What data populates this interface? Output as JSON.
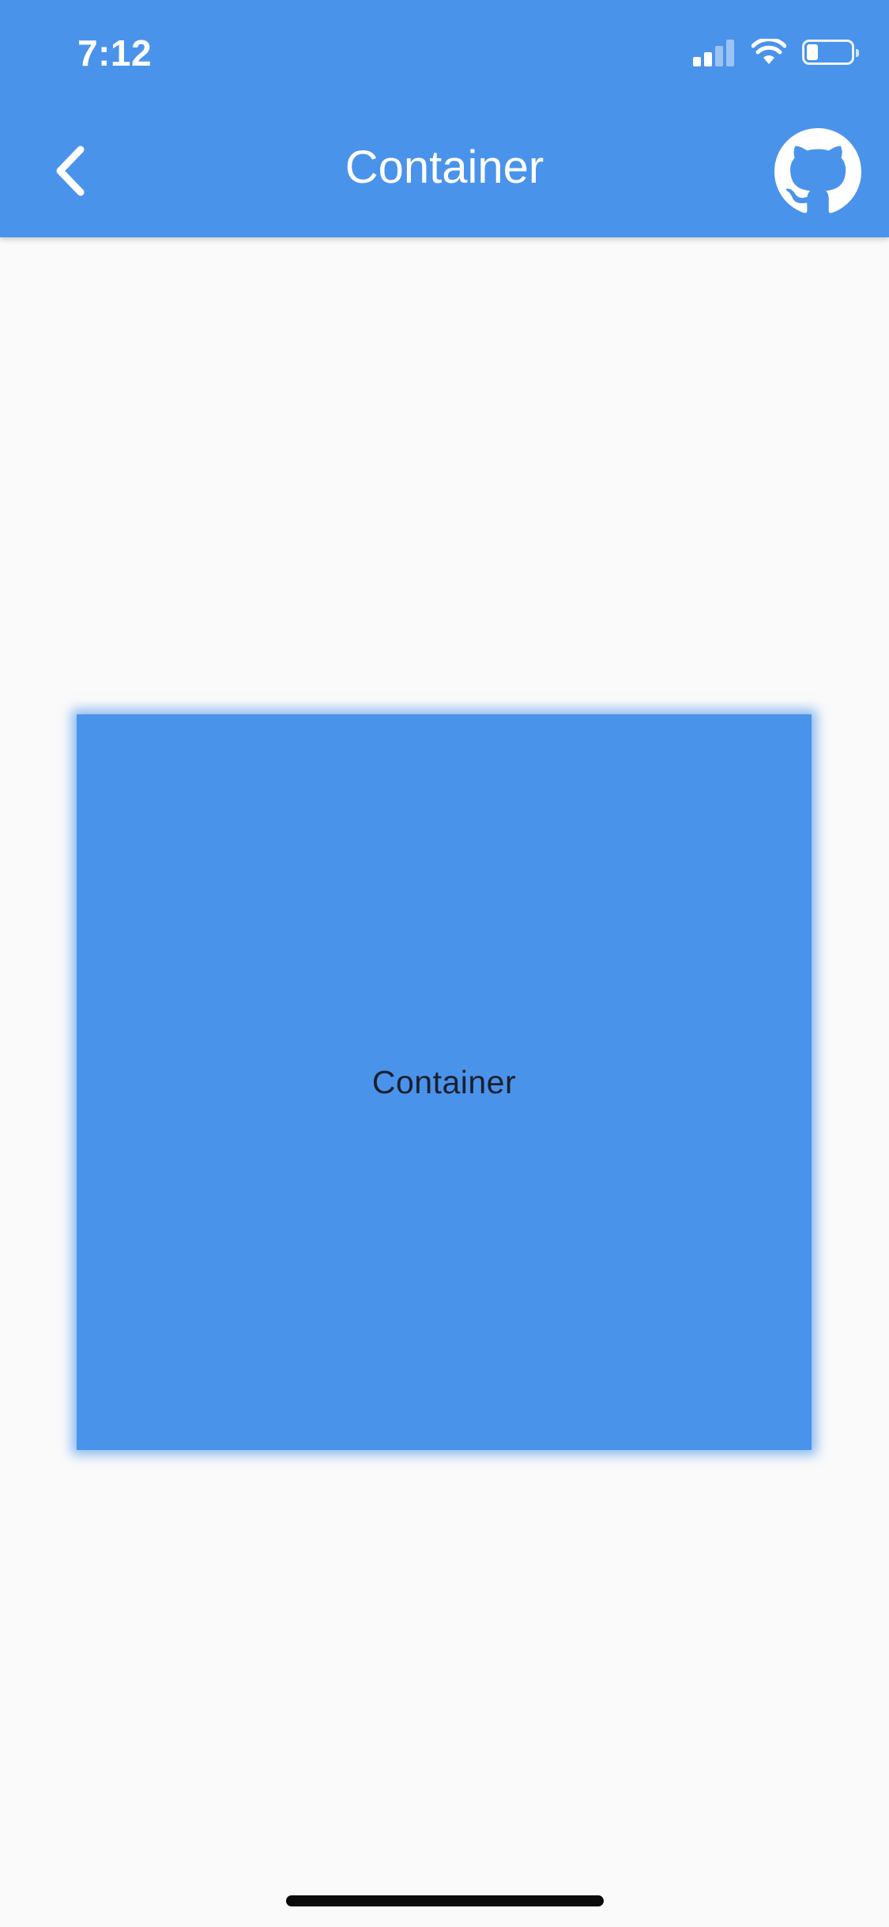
{
  "status_bar": {
    "time": "7:12",
    "icons": [
      "signal-icon",
      "wifi-icon",
      "battery-icon"
    ]
  },
  "app_bar": {
    "title": "Container",
    "back_icon": "chevron-left-icon",
    "action_icon": "github-icon",
    "background_color": "#4a93eb"
  },
  "content": {
    "box_label": "Container",
    "box_color": "#4a93eb",
    "page_background": "#fafafa"
  }
}
